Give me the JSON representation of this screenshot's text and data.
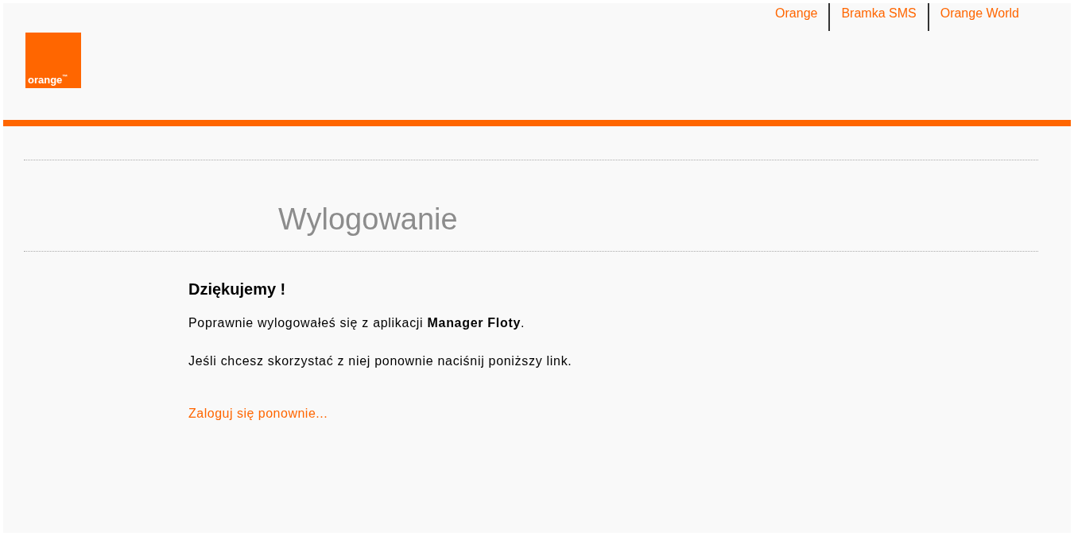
{
  "logo": {
    "text": "orange",
    "mark": "™"
  },
  "top_links": [
    "Orange",
    "Bramka SMS",
    "Orange World"
  ],
  "title": "Wylogowanie",
  "heading": "Dziękujemy !",
  "paragraphs": [
    "Poprawnie wylogowałeś się z aplikacji **Manager Floty**.",
    "Jeśli chcesz skorzystać z niej ponownie naciśnij poniższy link."
  ],
  "link": "Zaloguj się ponownie..."
}
